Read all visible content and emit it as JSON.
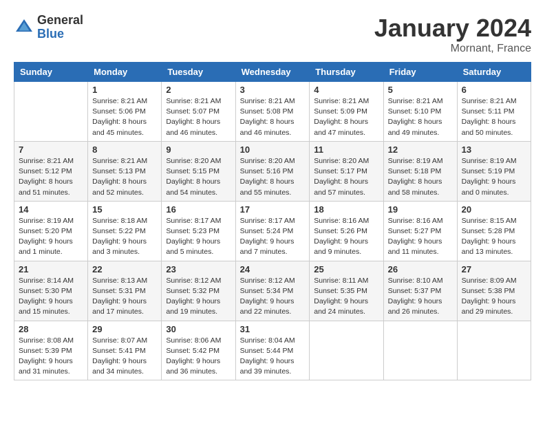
{
  "logo": {
    "general": "General",
    "blue": "Blue"
  },
  "title": "January 2024",
  "location": "Mornant, France",
  "weekdays": [
    "Sunday",
    "Monday",
    "Tuesday",
    "Wednesday",
    "Thursday",
    "Friday",
    "Saturday"
  ],
  "weeks": [
    [
      {
        "day": "",
        "info": ""
      },
      {
        "day": "1",
        "info": "Sunrise: 8:21 AM\nSunset: 5:06 PM\nDaylight: 8 hours\nand 45 minutes."
      },
      {
        "day": "2",
        "info": "Sunrise: 8:21 AM\nSunset: 5:07 PM\nDaylight: 8 hours\nand 46 minutes."
      },
      {
        "day": "3",
        "info": "Sunrise: 8:21 AM\nSunset: 5:08 PM\nDaylight: 8 hours\nand 46 minutes."
      },
      {
        "day": "4",
        "info": "Sunrise: 8:21 AM\nSunset: 5:09 PM\nDaylight: 8 hours\nand 47 minutes."
      },
      {
        "day": "5",
        "info": "Sunrise: 8:21 AM\nSunset: 5:10 PM\nDaylight: 8 hours\nand 49 minutes."
      },
      {
        "day": "6",
        "info": "Sunrise: 8:21 AM\nSunset: 5:11 PM\nDaylight: 8 hours\nand 50 minutes."
      }
    ],
    [
      {
        "day": "7",
        "info": "Sunrise: 8:21 AM\nSunset: 5:12 PM\nDaylight: 8 hours\nand 51 minutes."
      },
      {
        "day": "8",
        "info": "Sunrise: 8:21 AM\nSunset: 5:13 PM\nDaylight: 8 hours\nand 52 minutes."
      },
      {
        "day": "9",
        "info": "Sunrise: 8:20 AM\nSunset: 5:15 PM\nDaylight: 8 hours\nand 54 minutes."
      },
      {
        "day": "10",
        "info": "Sunrise: 8:20 AM\nSunset: 5:16 PM\nDaylight: 8 hours\nand 55 minutes."
      },
      {
        "day": "11",
        "info": "Sunrise: 8:20 AM\nSunset: 5:17 PM\nDaylight: 8 hours\nand 57 minutes."
      },
      {
        "day": "12",
        "info": "Sunrise: 8:19 AM\nSunset: 5:18 PM\nDaylight: 8 hours\nand 58 minutes."
      },
      {
        "day": "13",
        "info": "Sunrise: 8:19 AM\nSunset: 5:19 PM\nDaylight: 9 hours\nand 0 minutes."
      }
    ],
    [
      {
        "day": "14",
        "info": "Sunrise: 8:19 AM\nSunset: 5:20 PM\nDaylight: 9 hours\nand 1 minute."
      },
      {
        "day": "15",
        "info": "Sunrise: 8:18 AM\nSunset: 5:22 PM\nDaylight: 9 hours\nand 3 minutes."
      },
      {
        "day": "16",
        "info": "Sunrise: 8:17 AM\nSunset: 5:23 PM\nDaylight: 9 hours\nand 5 minutes."
      },
      {
        "day": "17",
        "info": "Sunrise: 8:17 AM\nSunset: 5:24 PM\nDaylight: 9 hours\nand 7 minutes."
      },
      {
        "day": "18",
        "info": "Sunrise: 8:16 AM\nSunset: 5:26 PM\nDaylight: 9 hours\nand 9 minutes."
      },
      {
        "day": "19",
        "info": "Sunrise: 8:16 AM\nSunset: 5:27 PM\nDaylight: 9 hours\nand 11 minutes."
      },
      {
        "day": "20",
        "info": "Sunrise: 8:15 AM\nSunset: 5:28 PM\nDaylight: 9 hours\nand 13 minutes."
      }
    ],
    [
      {
        "day": "21",
        "info": "Sunrise: 8:14 AM\nSunset: 5:30 PM\nDaylight: 9 hours\nand 15 minutes."
      },
      {
        "day": "22",
        "info": "Sunrise: 8:13 AM\nSunset: 5:31 PM\nDaylight: 9 hours\nand 17 minutes."
      },
      {
        "day": "23",
        "info": "Sunrise: 8:12 AM\nSunset: 5:32 PM\nDaylight: 9 hours\nand 19 minutes."
      },
      {
        "day": "24",
        "info": "Sunrise: 8:12 AM\nSunset: 5:34 PM\nDaylight: 9 hours\nand 22 minutes."
      },
      {
        "day": "25",
        "info": "Sunrise: 8:11 AM\nSunset: 5:35 PM\nDaylight: 9 hours\nand 24 minutes."
      },
      {
        "day": "26",
        "info": "Sunrise: 8:10 AM\nSunset: 5:37 PM\nDaylight: 9 hours\nand 26 minutes."
      },
      {
        "day": "27",
        "info": "Sunrise: 8:09 AM\nSunset: 5:38 PM\nDaylight: 9 hours\nand 29 minutes."
      }
    ],
    [
      {
        "day": "28",
        "info": "Sunrise: 8:08 AM\nSunset: 5:39 PM\nDaylight: 9 hours\nand 31 minutes."
      },
      {
        "day": "29",
        "info": "Sunrise: 8:07 AM\nSunset: 5:41 PM\nDaylight: 9 hours\nand 34 minutes."
      },
      {
        "day": "30",
        "info": "Sunrise: 8:06 AM\nSunset: 5:42 PM\nDaylight: 9 hours\nand 36 minutes."
      },
      {
        "day": "31",
        "info": "Sunrise: 8:04 AM\nSunset: 5:44 PM\nDaylight: 9 hours\nand 39 minutes."
      },
      {
        "day": "",
        "info": ""
      },
      {
        "day": "",
        "info": ""
      },
      {
        "day": "",
        "info": ""
      }
    ]
  ]
}
